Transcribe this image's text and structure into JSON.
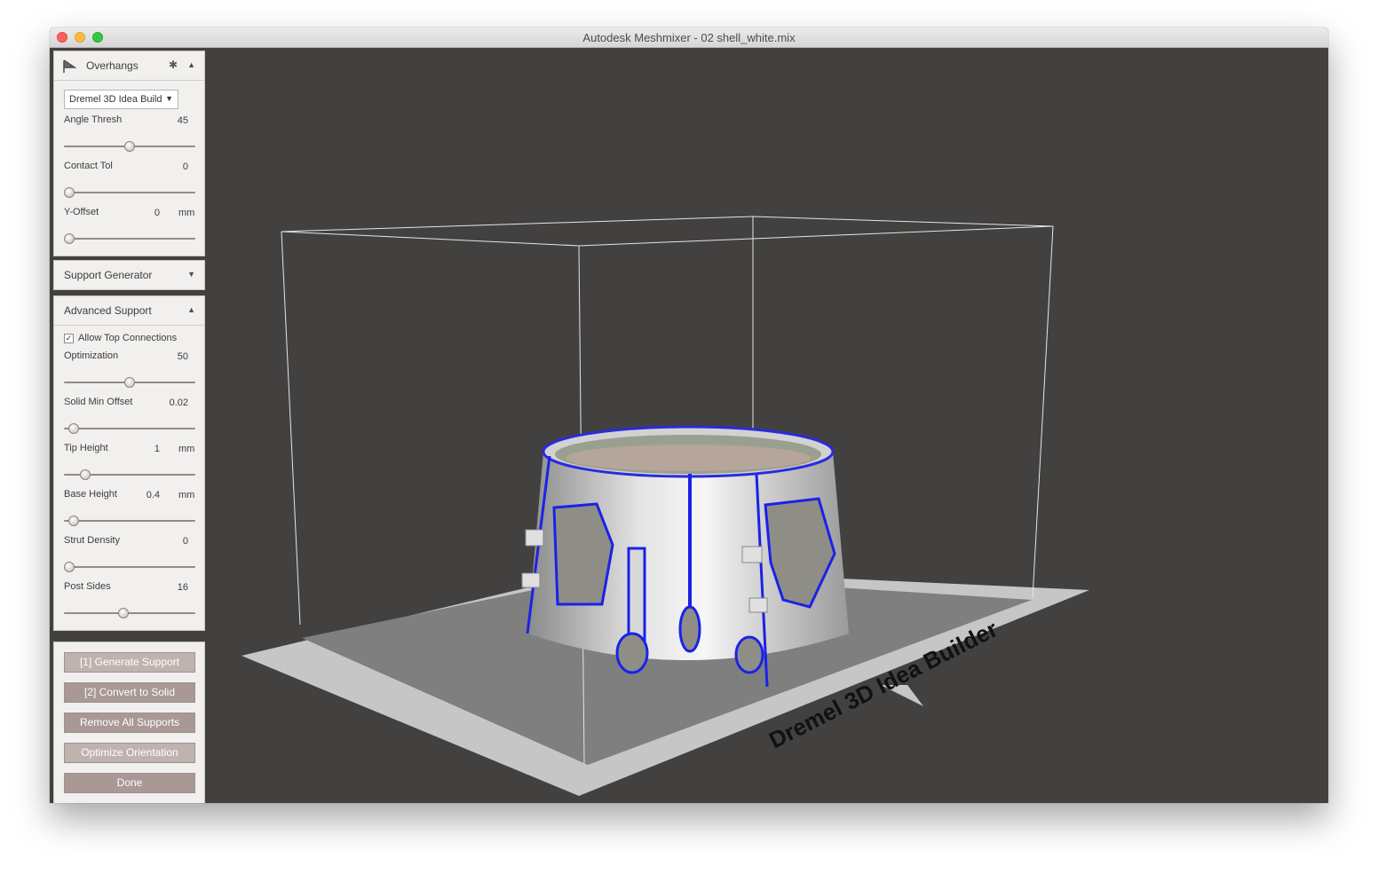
{
  "window": {
    "title": "Autodesk Meshmixer - 02 shell_white.mix"
  },
  "overhangs": {
    "title": "Overhangs",
    "printer_dropdown": "Dremel 3D Idea Build",
    "params": [
      {
        "label": "Angle Thresh",
        "value": "45",
        "unit": "",
        "slider_fraction": 0.5
      },
      {
        "label": "Contact Tol",
        "value": "0",
        "unit": "",
        "slider_fraction": 0.0
      },
      {
        "label": "Y-Offset",
        "value": "0",
        "unit": "mm",
        "slider_fraction": 0.0
      }
    ]
  },
  "support_generator": {
    "title": "Support Generator"
  },
  "advanced_support": {
    "title": "Advanced Support",
    "allow_top_connections": {
      "label": "Allow Top Connections",
      "checked": true
    },
    "params": [
      {
        "label": "Optimization",
        "value": "50",
        "unit": "",
        "slider_fraction": 0.5
      },
      {
        "label": "Solid Min Offset",
        "value": "0.02",
        "unit": "",
        "slider_fraction": 0.04
      },
      {
        "label": "Tip Height",
        "value": "1",
        "unit": "mm",
        "slider_fraction": 0.13
      },
      {
        "label": "Base Height",
        "value": "0.4",
        "unit": "mm",
        "slider_fraction": 0.04
      },
      {
        "label": "Strut Density",
        "value": "0",
        "unit": "",
        "slider_fraction": 0.0
      },
      {
        "label": "Post Sides",
        "value": "16",
        "unit": "",
        "slider_fraction": 0.45
      }
    ]
  },
  "actions": {
    "generate_support": "[1] Generate Support",
    "convert_to_solid": "[2] Convert to Solid",
    "remove_all_supports": "Remove All Supports",
    "optimize_orientation": "Optimize Orientation",
    "done": "Done"
  },
  "viewport": {
    "bed_label": "Dremel 3D Idea Builder"
  }
}
